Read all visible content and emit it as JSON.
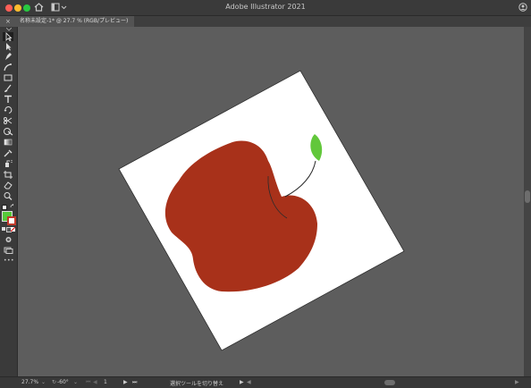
{
  "window": {
    "title": "Adobe Illustrator 2021"
  },
  "document_tab": {
    "close_glyph": "×",
    "label": "名称未設定-1* @ 27.7 % (RGB/プレビュー)"
  },
  "toolbar": {
    "tools": [
      "selection-icon",
      "direct-selection-icon",
      "pen-icon",
      "curvature-pen-icon",
      "rectangle-icon",
      "paintbrush-icon",
      "type-icon",
      "rotate-icon",
      "scissors-icon",
      "shape-builder-icon",
      "gradient-icon",
      "eyedropper-icon",
      "symbol-sprayer-icon",
      "artboard-icon",
      "eraser-icon",
      "zoom-icon",
      "hand-icon"
    ],
    "fill_color": "#56c93a",
    "stroke_color": "#ffffff",
    "more_glyph": "•••"
  },
  "artwork": {
    "artboard_color": "#ffffff",
    "apple_color": "#a8311a",
    "leaf_color": "#62c73b",
    "stem_color": "#2b2b2b"
  },
  "status": {
    "zoom": "27.7%",
    "rotation": "-60°",
    "artboard_number": "1",
    "tool_hint": "選択ツールを切り替え"
  }
}
